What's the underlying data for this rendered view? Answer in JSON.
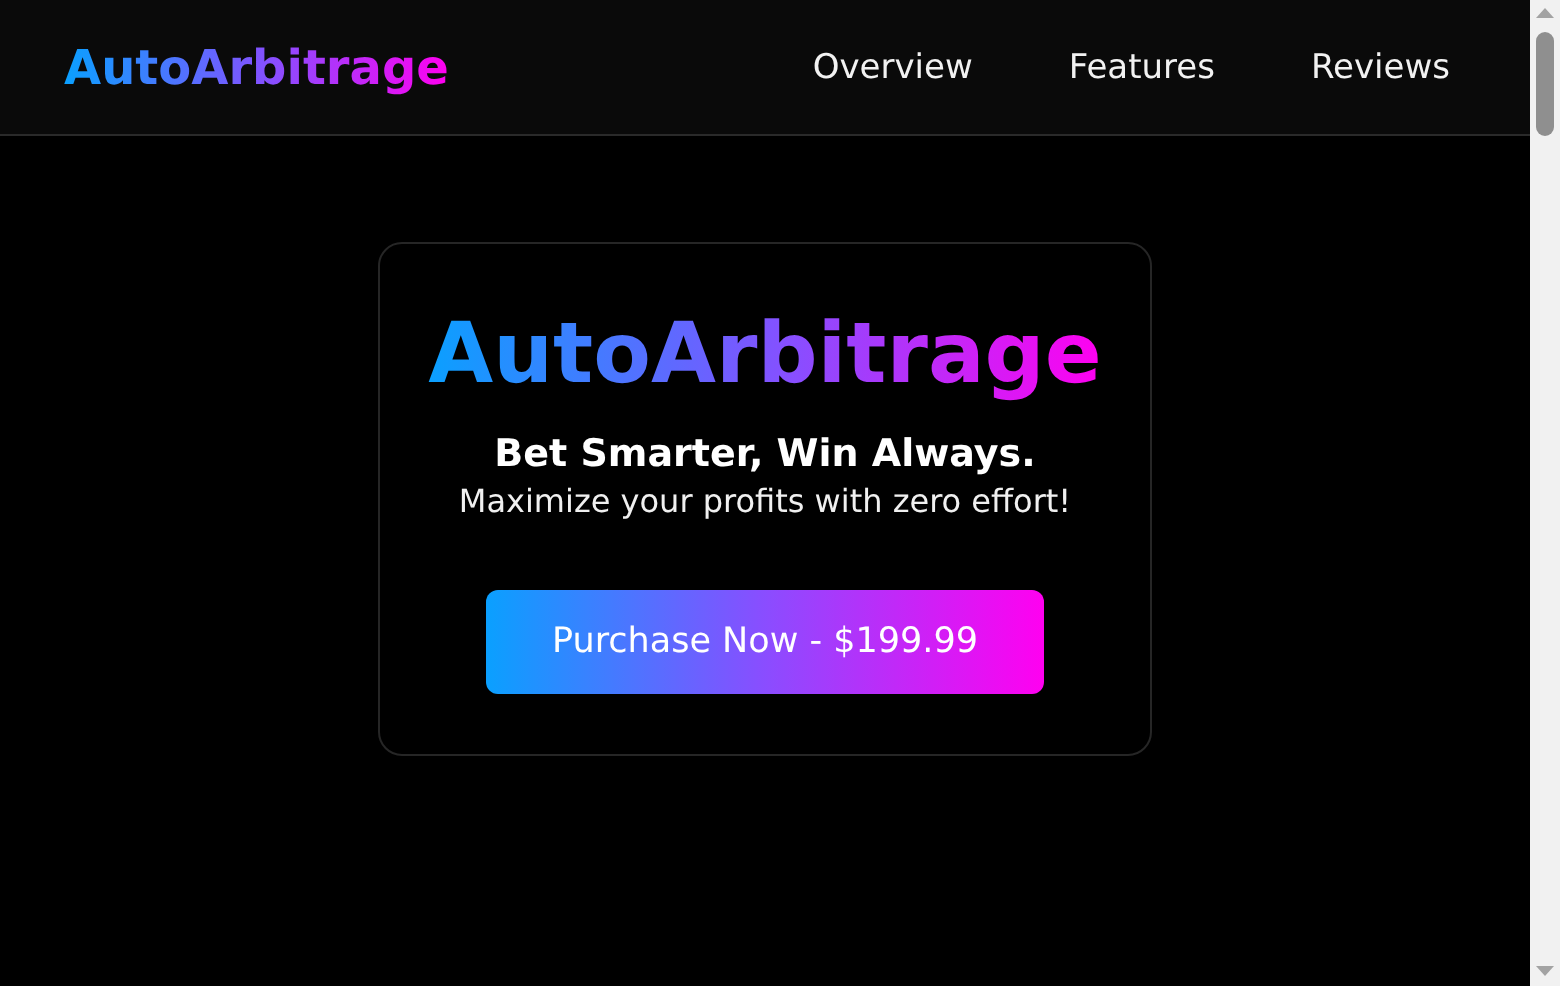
{
  "header": {
    "logo": "AutoArbitrage",
    "nav": [
      "Overview",
      "Features",
      "Reviews"
    ]
  },
  "hero": {
    "title": "AutoArbitrage",
    "tagline": "Bet Smarter, Win Always.",
    "subtitle": "Maximize your profits with zero effort!",
    "button": "Purchase Now - $199.99"
  }
}
